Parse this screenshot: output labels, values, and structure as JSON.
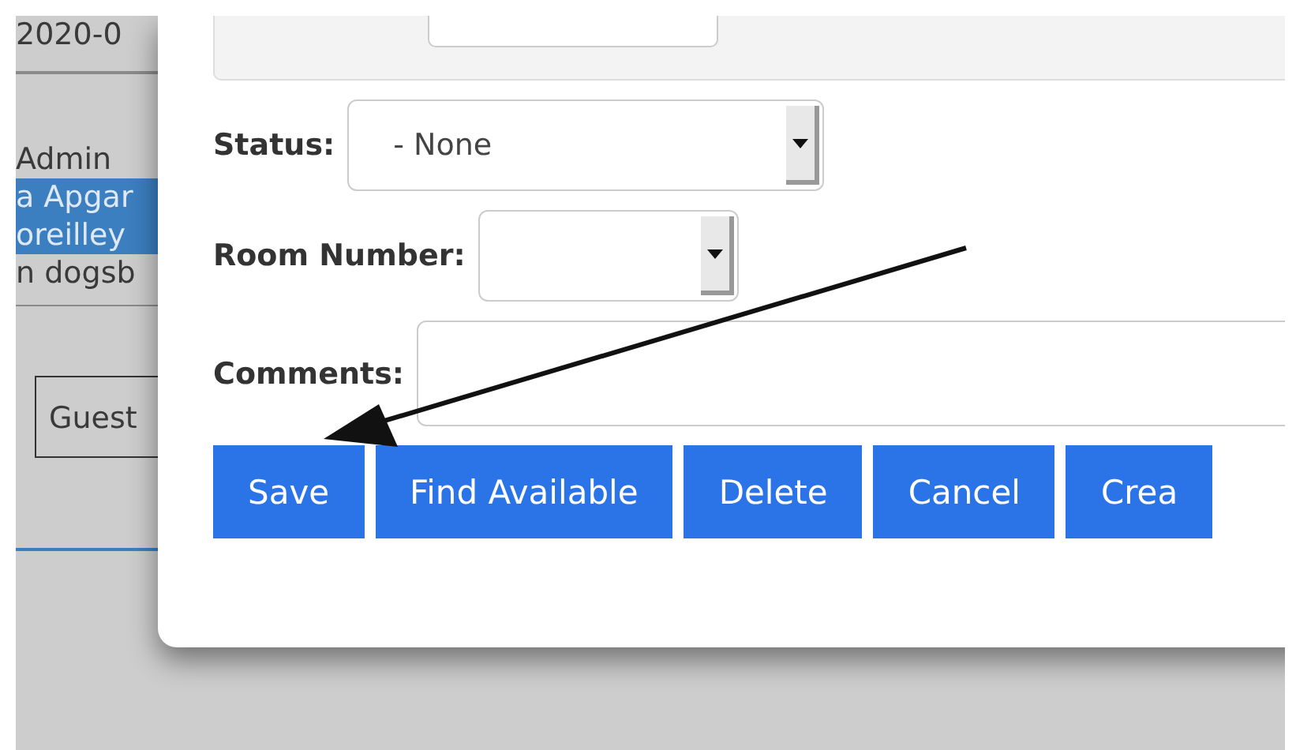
{
  "background_page": {
    "date": "2020-0",
    "rows": [
      {
        "text": "Admin",
        "selected": false
      },
      {
        "text": "a Apgar",
        "selected": true
      },
      {
        "text": "oreilley",
        "selected": true
      },
      {
        "text": "n dogsb",
        "selected": false
      }
    ],
    "guest": "Guest"
  },
  "dialog": {
    "status": {
      "label": "Status:",
      "value": "- None"
    },
    "room_number": {
      "label": "Room Number:"
    },
    "comments": {
      "label": "Comments:"
    },
    "buttons": [
      "Save",
      "Find Available",
      "Delete",
      "Cancel",
      "Crea"
    ]
  }
}
